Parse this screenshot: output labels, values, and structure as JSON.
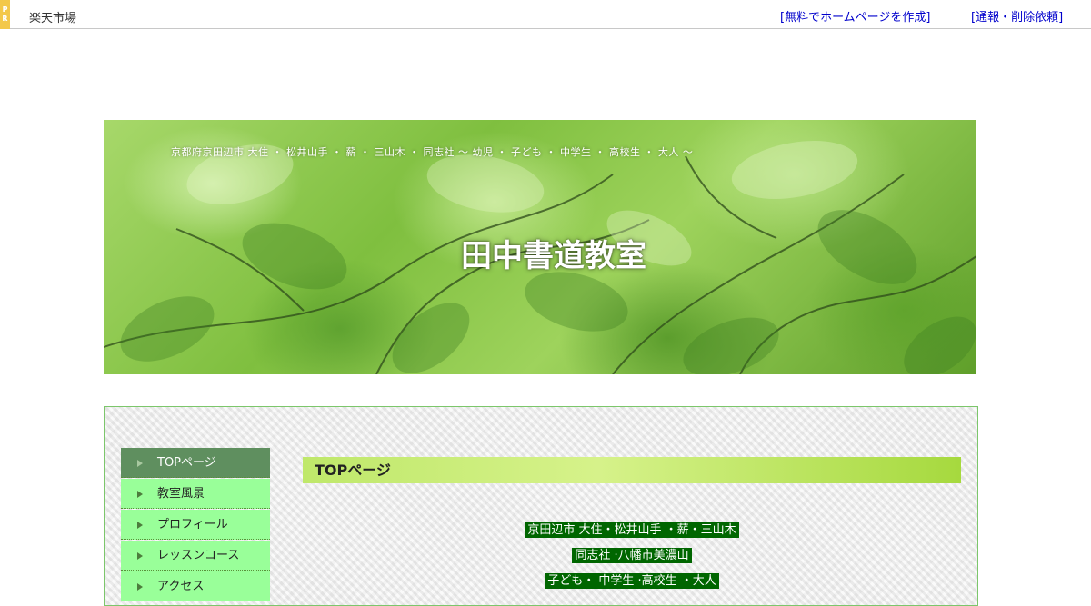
{
  "pr_bar": {
    "tag_letters": [
      "P",
      "R"
    ],
    "left_link": "楽天市場",
    "right_links": [
      "[無料でホームページを作成]",
      "[通報・削除依頼]"
    ]
  },
  "banner": {
    "subtitle": "京都府京田辺市  大住 ・ 松井山手 ・ 薪 ・ 三山木 ・ 同志社      ～ 幼児 ・ 子ども ・ 中学生 ・ 高校生 ・ 大人 ～",
    "title": "田中書道教室"
  },
  "menu": {
    "items": [
      {
        "label": "TOPページ",
        "active": true
      },
      {
        "label": "教室風景",
        "active": false
      },
      {
        "label": "プロフィール",
        "active": false
      },
      {
        "label": "レッスンコース",
        "active": false
      },
      {
        "label": "アクセス",
        "active": false
      }
    ]
  },
  "main": {
    "heading": "TOPページ",
    "tag_lines": [
      "京田辺市  大住・松井山手 ・薪・三山木",
      "同志社 ·八幡市美濃山",
      "子ども・ 中学生 ·高校生 ・大人"
    ]
  },
  "colors": {
    "menu_bg": "#99ff99",
    "menu_active_bg": "#5f8f5f",
    "heading_bg": "#bfe86a",
    "tag_bg": "#006600",
    "link": "#0000cc"
  }
}
